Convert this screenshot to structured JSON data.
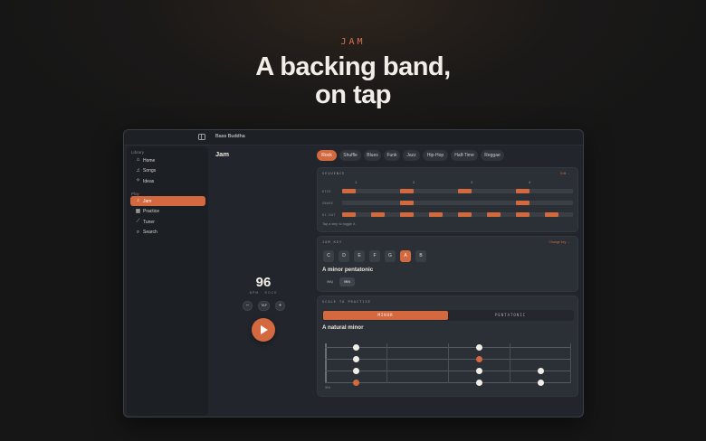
{
  "hero": {
    "eyebrow": "JAM",
    "title_line1": "A backing band,",
    "title_line2": "on tap"
  },
  "window": {
    "title": "Bass Buddha"
  },
  "sidebar": {
    "library_label": "Library",
    "library_items": [
      {
        "label": "Home",
        "icon": "home-icon",
        "glyph": "⌂"
      },
      {
        "label": "Songs",
        "icon": "music-icon",
        "glyph": "♫"
      },
      {
        "label": "Ideas",
        "icon": "lightbulb-icon",
        "glyph": "✧"
      }
    ],
    "play_label": "Play",
    "play_items": [
      {
        "label": "Jam",
        "icon": "jam-icon",
        "glyph": "♪",
        "active": true
      },
      {
        "label": "Practice",
        "icon": "grid-icon",
        "glyph": "▦"
      },
      {
        "label": "Tuner",
        "icon": "tuner-icon",
        "glyph": "⟋"
      },
      {
        "label": "Search",
        "icon": "search-icon",
        "glyph": "⌕"
      }
    ]
  },
  "jam": {
    "title": "Jam",
    "bpm": "96",
    "bpm_label": "BPM · ROCK",
    "minus": "−",
    "tap": "TAP",
    "plus": "+"
  },
  "styles": [
    "Rock",
    "Shuffle",
    "Blues",
    "Funk",
    "Jazz",
    "Hip-Hop",
    "Half-Time",
    "Reggae"
  ],
  "selected_style": "Rock",
  "sequencer": {
    "title": "SEQUENCE",
    "link": "Edit →",
    "beats": [
      "1",
      "2",
      "3",
      "4"
    ],
    "rows": [
      {
        "label": "KICK",
        "steps": [
          1,
          0,
          0,
          0,
          1,
          0,
          0,
          0,
          1,
          0,
          0,
          0,
          1,
          0,
          0,
          0
        ]
      },
      {
        "label": "SNARE",
        "steps": [
          0,
          0,
          0,
          0,
          1,
          0,
          0,
          0,
          0,
          0,
          0,
          0,
          1,
          0,
          0,
          0
        ]
      },
      {
        "label": "HI-HAT",
        "steps": [
          1,
          0,
          1,
          0,
          1,
          0,
          1,
          0,
          1,
          0,
          1,
          0,
          1,
          0,
          1,
          0
        ]
      }
    ],
    "hint": "Tap a step to toggle it."
  },
  "jam_key": {
    "title": "JAM KEY",
    "link": "Change key →",
    "keys": [
      "C",
      "D",
      "E",
      "F",
      "G",
      "A",
      "B"
    ],
    "selected": "A",
    "scale_name": "A minor pentatonic",
    "modes": [
      "MAJ",
      "MIN"
    ],
    "selected_mode": "MIN"
  },
  "scale_practise": {
    "title": "SCALE TO PRACTISE",
    "options": [
      "MINOR",
      "PENTATONIC"
    ],
    "selected": "MINOR",
    "scale_name": "A natural minor",
    "fret_label": "5th"
  },
  "colors": {
    "accent": "#d4693f",
    "background": "#1b1918",
    "panel": "#2b2f36"
  }
}
